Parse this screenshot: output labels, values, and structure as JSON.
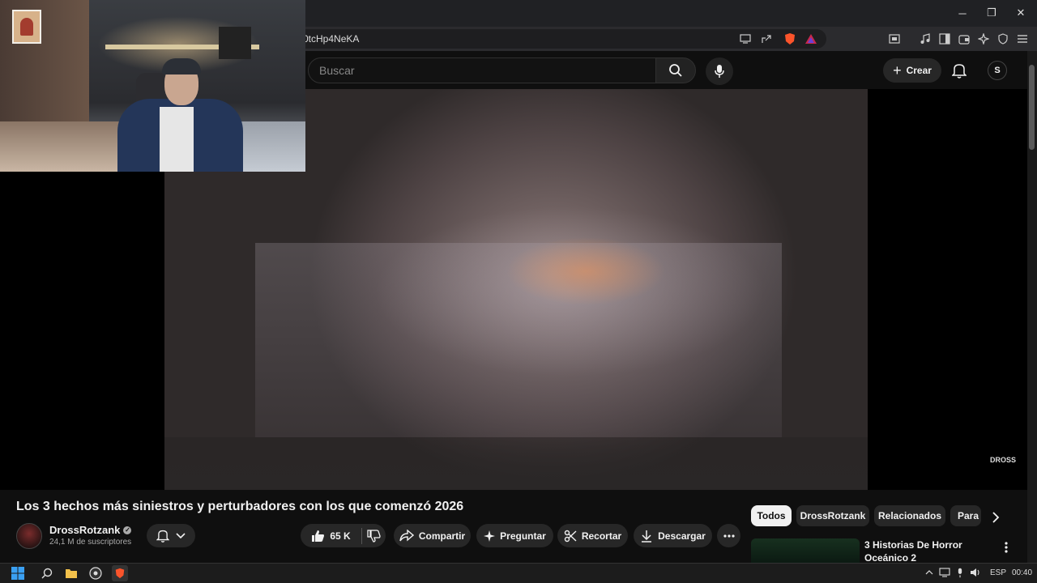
{
  "browser": {
    "url_fragment": "0tcHp4NeKA",
    "window_controls": {
      "minimize": "─",
      "maximize": "❐",
      "close": "✕"
    }
  },
  "youtube_header": {
    "search_placeholder": "Buscar",
    "create_label": "Crear",
    "avatar_initial": "S"
  },
  "video": {
    "title": "Los 3 hechos más siniestros y perturbadores con los que comenzó 2026",
    "watermark": "DROSS",
    "channel": {
      "name": "DrossRotzank",
      "verified_mark": "✓",
      "subscribers": "24,1 M de suscriptores"
    },
    "actions": {
      "likes": "65 K",
      "share": "Compartir",
      "ask": "Preguntar",
      "clip": "Recortar",
      "download": "Descargar"
    }
  },
  "chips": [
    "Todos",
    "DrossRotzank",
    "Relacionados",
    "Para"
  ],
  "related": [
    {
      "title": "3 Historias De Horror Oceánico 2"
    }
  ],
  "taskbar": {
    "language": "ESP",
    "time": "00:40"
  },
  "colors": {
    "background": "#0f0f0f",
    "pill": "#272727",
    "text": "#f1f1f1",
    "secondary_text": "#aaaaaa",
    "brave_orange": "#fb542b"
  }
}
